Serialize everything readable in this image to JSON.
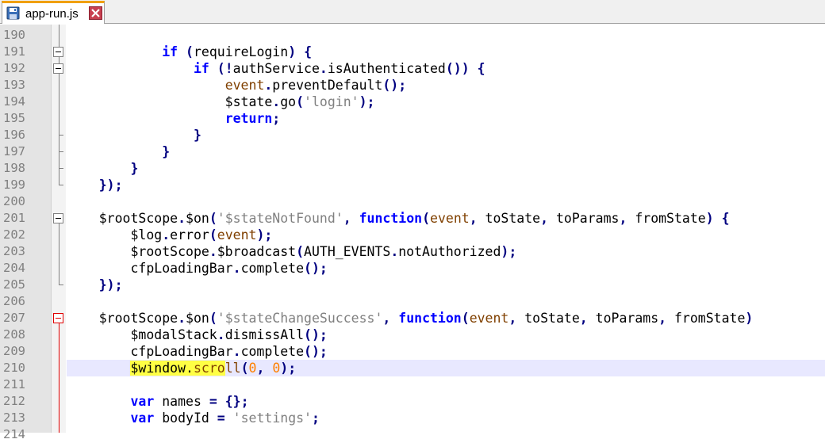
{
  "tab": {
    "filename": "app-run.js"
  },
  "colors": {
    "keyword": "#0000ff",
    "operator": "#000080",
    "string": "#808080",
    "number": "#ff8000",
    "highlight": "#ffff44",
    "fold_active": "#e00000"
  },
  "lines": [
    {
      "num": "190",
      "tokens": []
    },
    {
      "num": "191",
      "tokens": [
        {
          "t": "            "
        },
        {
          "t": "if",
          "c": "kw"
        },
        {
          "t": " "
        },
        {
          "t": "(",
          "c": "op"
        },
        {
          "t": "requireLogin"
        },
        {
          "t": ")",
          "c": "op"
        },
        {
          "t": " "
        },
        {
          "t": "{",
          "c": "op"
        }
      ]
    },
    {
      "num": "192",
      "tokens": [
        {
          "t": "                "
        },
        {
          "t": "if",
          "c": "kw"
        },
        {
          "t": " "
        },
        {
          "t": "(!",
          "c": "op"
        },
        {
          "t": "authService"
        },
        {
          "t": ".",
          "c": "op"
        },
        {
          "t": "isAuthenticated"
        },
        {
          "t": "())",
          "c": "op"
        },
        {
          "t": " "
        },
        {
          "t": "{",
          "c": "op"
        }
      ]
    },
    {
      "num": "193",
      "tokens": [
        {
          "t": "                    "
        },
        {
          "t": "event",
          "c": "mth"
        },
        {
          "t": ".",
          "c": "op"
        },
        {
          "t": "preventDefault"
        },
        {
          "t": "();",
          "c": "op"
        }
      ]
    },
    {
      "num": "194",
      "tokens": [
        {
          "t": "                    $state"
        },
        {
          "t": ".",
          "c": "op"
        },
        {
          "t": "go"
        },
        {
          "t": "(",
          "c": "op"
        },
        {
          "t": "'login'",
          "c": "str"
        },
        {
          "t": ");",
          "c": "op"
        }
      ]
    },
    {
      "num": "195",
      "tokens": [
        {
          "t": "                    "
        },
        {
          "t": "return",
          "c": "kw"
        },
        {
          "t": ";",
          "c": "op"
        }
      ]
    },
    {
      "num": "196",
      "tokens": [
        {
          "t": "                "
        },
        {
          "t": "}",
          "c": "op"
        }
      ]
    },
    {
      "num": "197",
      "tokens": [
        {
          "t": "            "
        },
        {
          "t": "}",
          "c": "op"
        }
      ]
    },
    {
      "num": "198",
      "tokens": [
        {
          "t": "        "
        },
        {
          "t": "}",
          "c": "op"
        }
      ]
    },
    {
      "num": "199",
      "tokens": [
        {
          "t": "    "
        },
        {
          "t": "});",
          "c": "op"
        }
      ]
    },
    {
      "num": "200",
      "tokens": []
    },
    {
      "num": "201",
      "tokens": [
        {
          "t": "    $rootScope"
        },
        {
          "t": ".",
          "c": "op"
        },
        {
          "t": "$on"
        },
        {
          "t": "(",
          "c": "op"
        },
        {
          "t": "'$stateNotFound'",
          "c": "str"
        },
        {
          "t": ",",
          "c": "op"
        },
        {
          "t": " "
        },
        {
          "t": "function",
          "c": "kw"
        },
        {
          "t": "(",
          "c": "op"
        },
        {
          "t": "event",
          "c": "mth"
        },
        {
          "t": ",",
          "c": "op"
        },
        {
          "t": " toState"
        },
        {
          "t": ",",
          "c": "op"
        },
        {
          "t": " toParams"
        },
        {
          "t": ",",
          "c": "op"
        },
        {
          "t": " fromState"
        },
        {
          "t": ")",
          "c": "op"
        },
        {
          "t": " "
        },
        {
          "t": "{",
          "c": "op"
        }
      ]
    },
    {
      "num": "202",
      "tokens": [
        {
          "t": "        $log"
        },
        {
          "t": ".",
          "c": "op"
        },
        {
          "t": "error"
        },
        {
          "t": "(",
          "c": "op"
        },
        {
          "t": "event",
          "c": "mth"
        },
        {
          "t": ");",
          "c": "op"
        }
      ]
    },
    {
      "num": "203",
      "tokens": [
        {
          "t": "        $rootScope"
        },
        {
          "t": ".",
          "c": "op"
        },
        {
          "t": "$broadcast"
        },
        {
          "t": "(",
          "c": "op"
        },
        {
          "t": "AUTH_EVENTS"
        },
        {
          "t": ".",
          "c": "op"
        },
        {
          "t": "notAuthorized"
        },
        {
          "t": ");",
          "c": "op"
        }
      ]
    },
    {
      "num": "204",
      "tokens": [
        {
          "t": "        cfpLoadingBar"
        },
        {
          "t": ".",
          "c": "op"
        },
        {
          "t": "complete"
        },
        {
          "t": "();",
          "c": "op"
        }
      ]
    },
    {
      "num": "205",
      "tokens": [
        {
          "t": "    "
        },
        {
          "t": "});",
          "c": "op"
        }
      ]
    },
    {
      "num": "206",
      "tokens": []
    },
    {
      "num": "207",
      "tokens": [
        {
          "t": "    $rootScope"
        },
        {
          "t": ".",
          "c": "op"
        },
        {
          "t": "$on"
        },
        {
          "t": "(",
          "c": "op"
        },
        {
          "t": "'$stateChangeSuccess'",
          "c": "str"
        },
        {
          "t": ",",
          "c": "op"
        },
        {
          "t": " "
        },
        {
          "t": "function",
          "c": "kw"
        },
        {
          "t": "(",
          "c": "op"
        },
        {
          "t": "event",
          "c": "mth"
        },
        {
          "t": ",",
          "c": "op"
        },
        {
          "t": " toState"
        },
        {
          "t": ",",
          "c": "op"
        },
        {
          "t": " toParams"
        },
        {
          "t": ",",
          "c": "op"
        },
        {
          "t": " fromState"
        },
        {
          "t": ")",
          "c": "op"
        }
      ]
    },
    {
      "num": "208",
      "tokens": [
        {
          "t": "        $modalStack"
        },
        {
          "t": ".",
          "c": "op"
        },
        {
          "t": "dismissAll"
        },
        {
          "t": "();",
          "c": "op"
        }
      ]
    },
    {
      "num": "209",
      "tokens": [
        {
          "t": "        cfpLoadingBar"
        },
        {
          "t": ".",
          "c": "op"
        },
        {
          "t": "complete"
        },
        {
          "t": "();",
          "c": "op"
        }
      ]
    },
    {
      "num": "210",
      "current": true,
      "tokens": [
        {
          "t": "        "
        },
        {
          "t": "$window.",
          "c": "hl"
        },
        {
          "t": "scro",
          "c": "hl mth"
        },
        {
          "t": "ll",
          "c": "mth"
        },
        {
          "t": "(",
          "c": "op"
        },
        {
          "t": "0",
          "c": "num"
        },
        {
          "t": ",",
          "c": "op"
        },
        {
          "t": " "
        },
        {
          "t": "0",
          "c": "num"
        },
        {
          "t": ");",
          "c": "op"
        }
      ]
    },
    {
      "num": "211",
      "tokens": []
    },
    {
      "num": "212",
      "tokens": [
        {
          "t": "        "
        },
        {
          "t": "var",
          "c": "kw"
        },
        {
          "t": " names "
        },
        {
          "t": "=",
          "c": "op"
        },
        {
          "t": " "
        },
        {
          "t": "{};",
          "c": "op"
        }
      ]
    },
    {
      "num": "213",
      "tokens": [
        {
          "t": "        "
        },
        {
          "t": "var",
          "c": "kw"
        },
        {
          "t": " bodyId "
        },
        {
          "t": "=",
          "c": "op"
        },
        {
          "t": " "
        },
        {
          "t": "'settings'",
          "c": "str"
        },
        {
          "t": ";",
          "c": "op"
        }
      ]
    },
    {
      "num": "214",
      "tokens": []
    }
  ]
}
